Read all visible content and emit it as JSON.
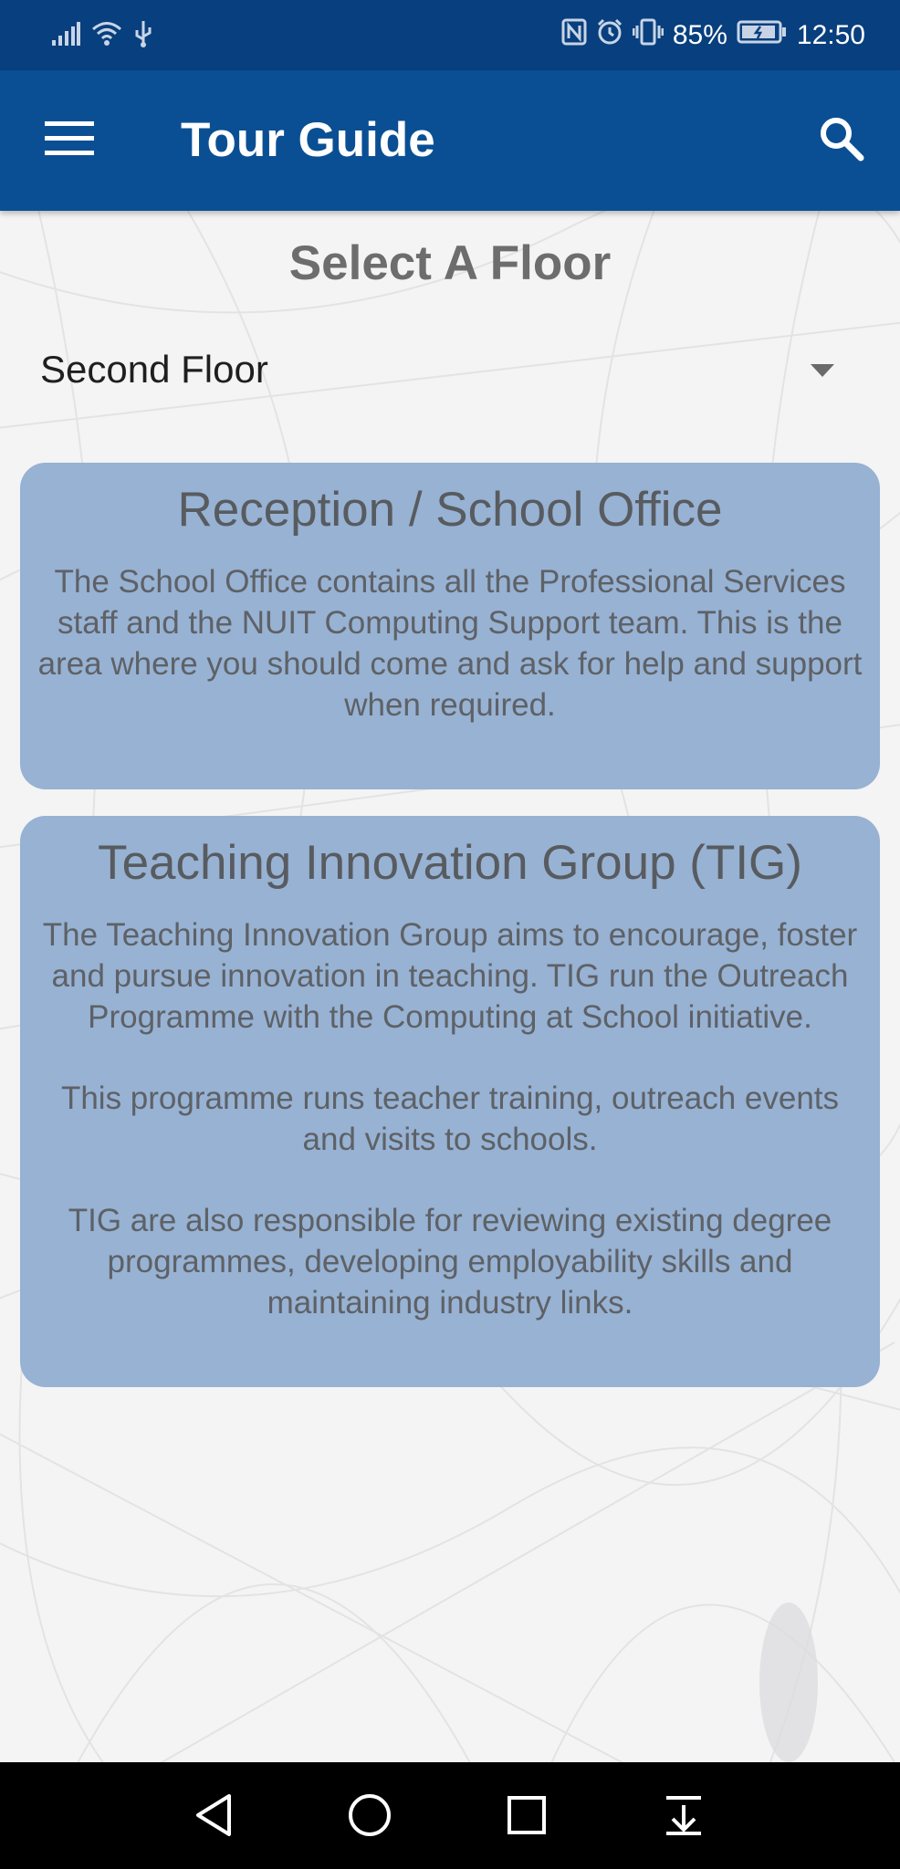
{
  "status_bar": {
    "battery_text": "85%",
    "time": "12:50",
    "icons": [
      "signal-icon",
      "wifi-icon",
      "usb-icon",
      "nfc-icon",
      "alarm-icon",
      "vibrate-icon",
      "battery-icon"
    ]
  },
  "app_bar": {
    "title": "Tour Guide",
    "menu_icon": "hamburger-menu-icon",
    "search_icon": "search-icon",
    "color": "#0a4f94"
  },
  "floor_picker": {
    "heading": "Select A Floor",
    "selected": "Second Floor"
  },
  "cards": [
    {
      "title": "Reception / School Office",
      "paragraphs": [
        "The School Office contains all the Professional Services staff and the NUIT Computing Support team. This is the area where you should come and ask for help and support when required."
      ]
    },
    {
      "title": "Teaching Innovation Group (TIG)",
      "paragraphs": [
        "The Teaching Innovation Group aims to encourage, foster and pursue innovation in teaching. TIG run the Outreach Programme with the Computing at School initiative.",
        "This programme runs teacher training, outreach events and visits to schools.",
        "TIG are also responsible for reviewing existing degree programmes, developing employability skills and maintaining industry links."
      ]
    }
  ],
  "colors": {
    "status_bar": "#083f7e",
    "card_background": "#97b2d3",
    "nav_bar": "#000000"
  },
  "nav_bar": {
    "icons": [
      "back-icon",
      "home-icon",
      "recent-apps-icon",
      "notification-shade-icon"
    ]
  }
}
